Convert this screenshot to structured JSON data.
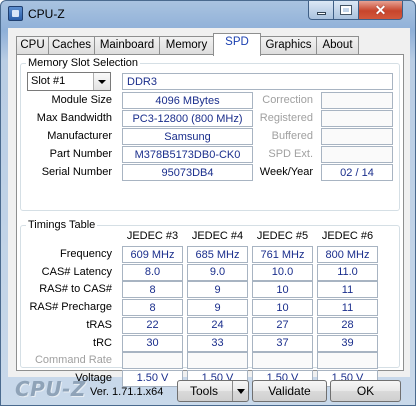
{
  "window": {
    "title": "CPU-Z"
  },
  "tabs": [
    "CPU",
    "Caches",
    "Mainboard",
    "Memory",
    "SPD",
    "Graphics",
    "About"
  ],
  "active_tab": "SPD",
  "memory_slot": {
    "group_title": "Memory Slot Selection",
    "slot_selected": "Slot #1",
    "type": "DDR3",
    "module_size": {
      "label": "Module Size",
      "value": "4096 MBytes"
    },
    "max_bandwidth": {
      "label": "Max Bandwidth",
      "value": "PC3-12800 (800 MHz)"
    },
    "manufacturer": {
      "label": "Manufacturer",
      "value": "Samsung"
    },
    "part_number": {
      "label": "Part Number",
      "value": "M378B5173DB0-CK0"
    },
    "serial_number": {
      "label": "Serial Number",
      "value": "95073DB4"
    },
    "correction": {
      "label": "Correction",
      "value": ""
    },
    "registered": {
      "label": "Registered",
      "value": ""
    },
    "buffered": {
      "label": "Buffered",
      "value": ""
    },
    "spd_ext": {
      "label": "SPD Ext.",
      "value": ""
    },
    "week_year": {
      "label": "Week/Year",
      "value": "02 / 14"
    }
  },
  "timings": {
    "group_title": "Timings Table",
    "columns": [
      "JEDEC #3",
      "JEDEC #4",
      "JEDEC #5",
      "JEDEC #6"
    ],
    "rows": [
      {
        "label": "Frequency",
        "values": [
          "609 MHz",
          "685 MHz",
          "761 MHz",
          "800 MHz"
        ]
      },
      {
        "label": "CAS# Latency",
        "values": [
          "8.0",
          "9.0",
          "10.0",
          "11.0"
        ]
      },
      {
        "label": "RAS# to CAS#",
        "values": [
          "8",
          "9",
          "10",
          "11"
        ]
      },
      {
        "label": "RAS# Precharge",
        "values": [
          "8",
          "9",
          "10",
          "11"
        ]
      },
      {
        "label": "tRAS",
        "values": [
          "22",
          "24",
          "27",
          "28"
        ]
      },
      {
        "label": "tRC",
        "values": [
          "30",
          "33",
          "37",
          "39"
        ]
      },
      {
        "label": "Command Rate",
        "values": [
          "",
          "",
          "",
          ""
        ]
      },
      {
        "label": "Voltage",
        "values": [
          "1.50 V",
          "1.50 V",
          "1.50 V",
          "1.50 V"
        ]
      }
    ]
  },
  "footer": {
    "brand": "CPU-Z",
    "version": "Ver. 1.71.1.x64",
    "tools_label": "Tools",
    "validate_label": "Validate",
    "ok_label": "OK"
  },
  "colors": {
    "value_text": "#1a2e8c",
    "title_gradient_top": "#a9c3e0",
    "close_red": "#c7452c"
  }
}
